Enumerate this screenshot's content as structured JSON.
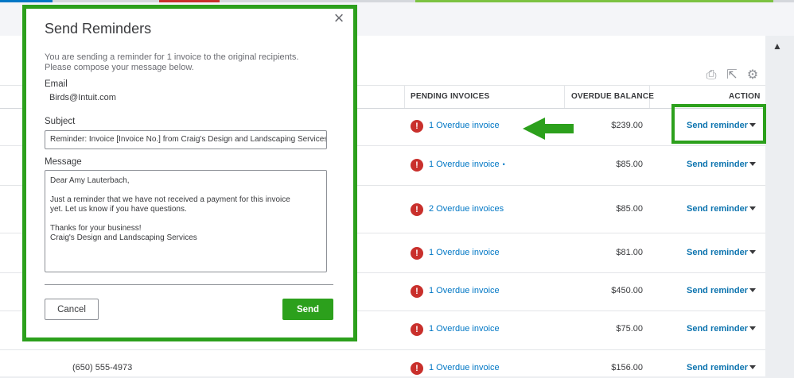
{
  "dialog": {
    "title": "Send Reminders",
    "intro": "You are sending a reminder for 1 invoice to the original recipients. Please compose your message below.",
    "email_label": "Email",
    "email_value": "Birds@Intuit.com",
    "subject_label": "Subject",
    "subject_value": "Reminder: Invoice [Invoice No.] from Craig's Design and Landscaping Services",
    "message_label": "Message",
    "message_lines": {
      "greeting": "Dear Amy Lauterbach,",
      "body1": "Just a reminder that we have not received a payment for this invoice",
      "body2": "yet. Let us know if you have questions.",
      "thanks": "Thanks for your business!",
      "signature": "Craig's Design and Landscaping Services"
    },
    "cancel_label": "Cancel",
    "send_label": "Send",
    "close_icon": "×"
  },
  "table": {
    "headers": {
      "pending": "PENDING INVOICES",
      "overdue": "OVERDUE BALANCE",
      "action": "ACTION"
    },
    "rows": [
      {
        "pending": "1 Overdue invoice",
        "balance": "$239.00",
        "action": "Send reminder"
      },
      {
        "pending": "1 Overdue invoice",
        "balance": "$85.00",
        "action": "Send reminder"
      },
      {
        "pending": "2 Overdue invoices",
        "balance": "$85.00",
        "action": "Send reminder"
      },
      {
        "pending": "1 Overdue invoice",
        "balance": "$81.00",
        "action": "Send reminder"
      },
      {
        "pending": "1 Overdue invoice",
        "balance": "$450.00",
        "action": "Send reminder"
      },
      {
        "pending": "1 Overdue invoice",
        "balance": "$75.00",
        "action": "Send reminder"
      },
      {
        "pending": "1 Overdue invoice",
        "balance": "$156.00",
        "action": "Send reminder",
        "phone": "(650) 555-4973"
      }
    ],
    "warn_glyph": "!"
  },
  "toolbar": {
    "icons": [
      "print-icon",
      "export-icon",
      "gear-icon"
    ],
    "print_glyph": "⎙",
    "export_glyph": "⇱",
    "gear_glyph": "⚙"
  },
  "colors": {
    "accent_green": "#2ca01c",
    "link_blue": "#0077c5",
    "warn_red": "#c9302c"
  }
}
